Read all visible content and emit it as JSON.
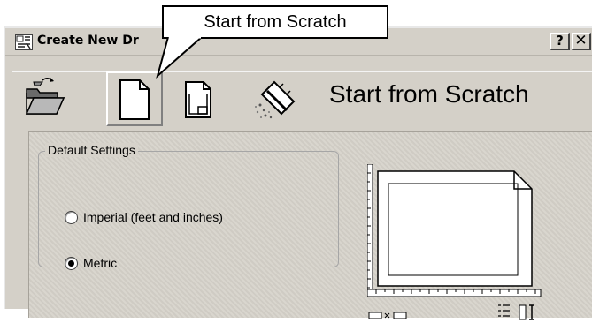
{
  "callout": {
    "text": "Start from Scratch"
  },
  "window": {
    "title": "Create New Dr",
    "app_icon": "drawing-app-icon",
    "help_label": "?",
    "close_label": "✕"
  },
  "toolbar": {
    "items": [
      {
        "icon": "open-folder-icon",
        "label": "Open a Drawing"
      },
      {
        "icon": "blank-page-icon",
        "label": "Start from Scratch",
        "selected": true
      },
      {
        "icon": "template-page-icon",
        "label": "Use a Template"
      },
      {
        "icon": "wizard-icon",
        "label": "Use a Wizard"
      }
    ]
  },
  "heading": "Start from Scratch",
  "settings": {
    "group_label": "Default Settings",
    "options": [
      {
        "label": "Imperial (feet and inches)",
        "selected": false
      },
      {
        "label": "Metric",
        "selected": true
      }
    ]
  },
  "preview": {
    "icon": "drawing-units-preview-icon"
  },
  "colors": {
    "face": "#d4d0c8",
    "panel": "#d6d2ca",
    "text": "#000000"
  }
}
